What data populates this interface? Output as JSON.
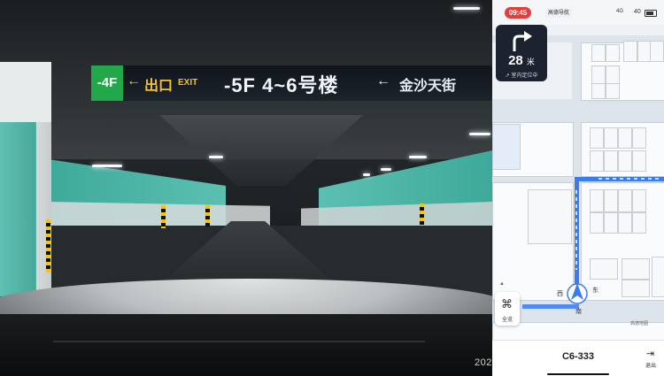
{
  "camera": {
    "sign": {
      "level": "-4F",
      "exit_arrow": "←",
      "exit_cn": "出口",
      "exit_en": "EXIT",
      "main": "-5F 4~6号楼",
      "right_arrow": "←",
      "right_cn": "金沙天街"
    },
    "timestamp": "202"
  },
  "status_bar": {
    "time": "09:45",
    "nav_badge": "高德导航",
    "signal": "4G",
    "network": "40"
  },
  "turn_card": {
    "icon": "turn-right-icon",
    "distance": "28",
    "unit": "米",
    "sub_text": "↗ 室内定位中"
  },
  "map": {
    "compass": {
      "west": "西",
      "east": "东",
      "south": "南"
    },
    "credit": "高德地图",
    "full_view_label": "全览",
    "collapse": "▲",
    "colors": {
      "route": "#3a7bf0",
      "background": "#eef1f5"
    }
  },
  "bottom": {
    "destination": "C6-333",
    "exit_label": "退出",
    "exit_icon": "exit-icon"
  }
}
